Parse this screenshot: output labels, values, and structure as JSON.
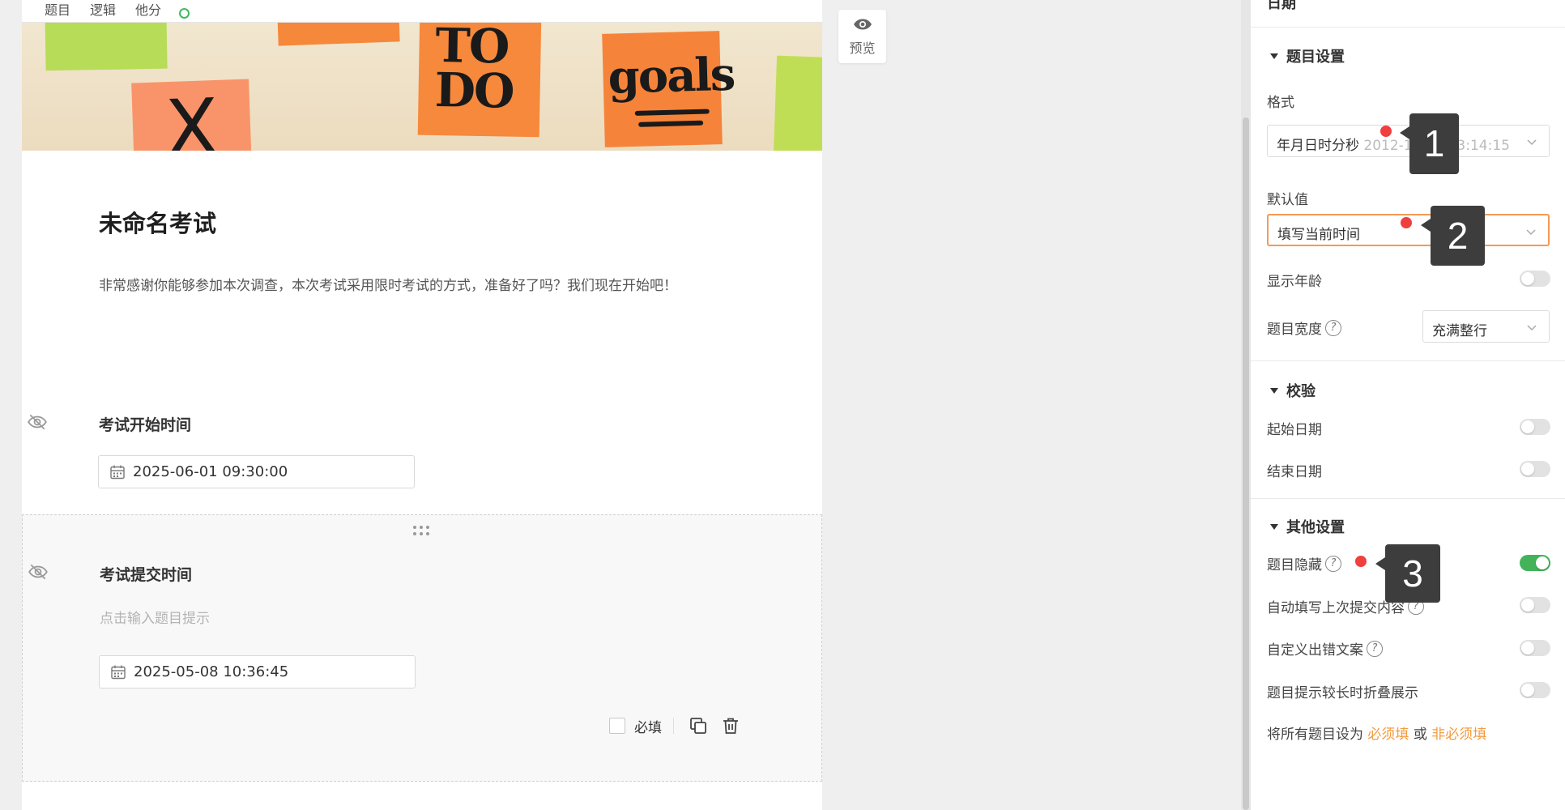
{
  "form": {
    "topbar": {
      "item1": "题目",
      "item2": "逻辑",
      "item3": "他分"
    },
    "banner": {
      "todo_text": "TO DO",
      "goals_text": "goals",
      "x_text": "X"
    },
    "title": "未命名考试",
    "description": "非常感谢你能够参加本次调查，本次考试采用限时考试的方式，准备好了吗？我们现在开始吧！",
    "questions": [
      {
        "title": "考试开始时间",
        "value": "2025-06-01 09:30:00"
      },
      {
        "title": "考试提交时间",
        "hint": "点击输入题目提示",
        "value": "2025-05-08 10:36:45",
        "required_label": "必填"
      }
    ]
  },
  "preview": {
    "label": "预览"
  },
  "panel": {
    "header": "日期",
    "question_settings": {
      "title": "题目设置",
      "format_label": "格式",
      "format_value": "年月日时分秒",
      "format_example": "2012-12-15 13:14:15",
      "default_label": "默认值",
      "default_value": "填写当前时间",
      "show_age_label": "显示年龄",
      "show_age": false,
      "width_label": "题目宽度",
      "width_value": "充满整行"
    },
    "validation": {
      "title": "校验",
      "start_date_label": "起始日期",
      "start_date": false,
      "end_date_label": "结束日期",
      "end_date": false
    },
    "other_settings": {
      "title": "其他设置",
      "hide_label": "题目隐藏",
      "hide": true,
      "autofill_label": "自动填写上次提交内容",
      "autofill": false,
      "custom_error_label": "自定义出错文案",
      "custom_error": false,
      "collapse_label": "题目提示较长时折叠展示",
      "collapse": false,
      "bulk_prefix": "将所有题目设为",
      "bulk_required": "必须填",
      "bulk_or": "或",
      "bulk_optional": "非必须填"
    }
  },
  "annotations": {
    "badge1": "1",
    "badge2": "2",
    "badge3": "3"
  },
  "colors": {
    "accent": "#f39a3d",
    "toggle_on": "#43b35a",
    "marker": "#ef3f3f"
  }
}
